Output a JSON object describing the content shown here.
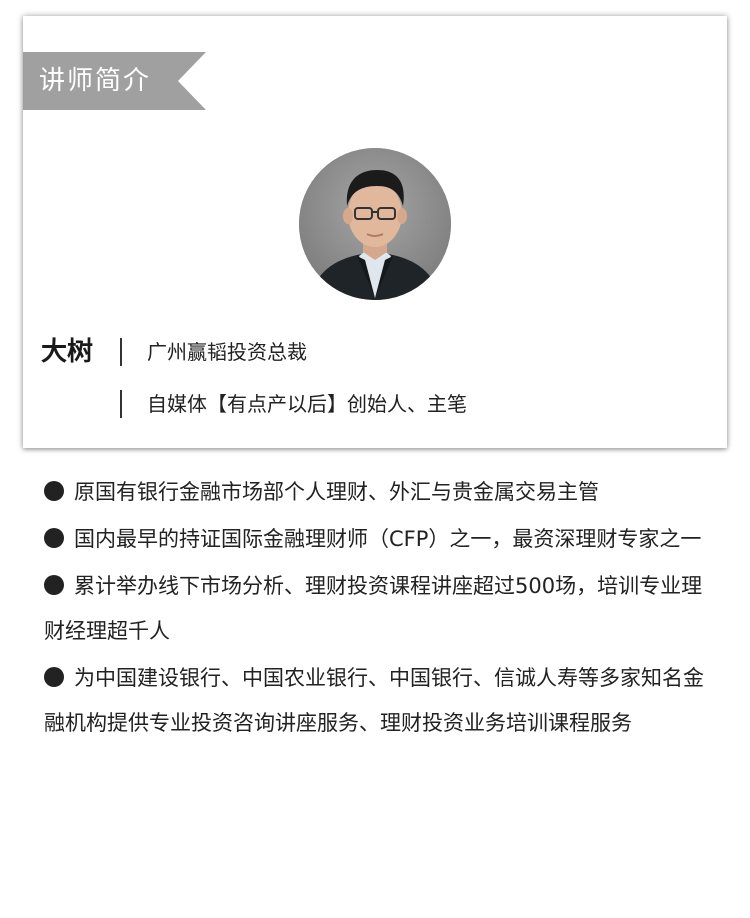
{
  "section": {
    "title": "讲师简介",
    "tag_color": "#a0a0a0"
  },
  "profile": {
    "name": "大树",
    "titles": [
      "广州赢韬投资总裁",
      "自媒体【有点产以后】创始人、主笔"
    ]
  },
  "bio": [
    "原国有银行金融市场部个人理财、外汇与贵金属交易主管",
    "国内最早的持证国际金融理财师（CFP）之一，最资深理财专家之一",
    "累计举办线下市场分析、理财投资课程讲座超过500场，培训专业理财经理超千人",
    "为中国建设银行、中国农业银行、中国银行、信诚人寿等多家知名金融机构提供专业投资咨询讲座服务、理财投资业务培训课程服务"
  ],
  "icons": {
    "bullet": "filled-circle-icon"
  }
}
